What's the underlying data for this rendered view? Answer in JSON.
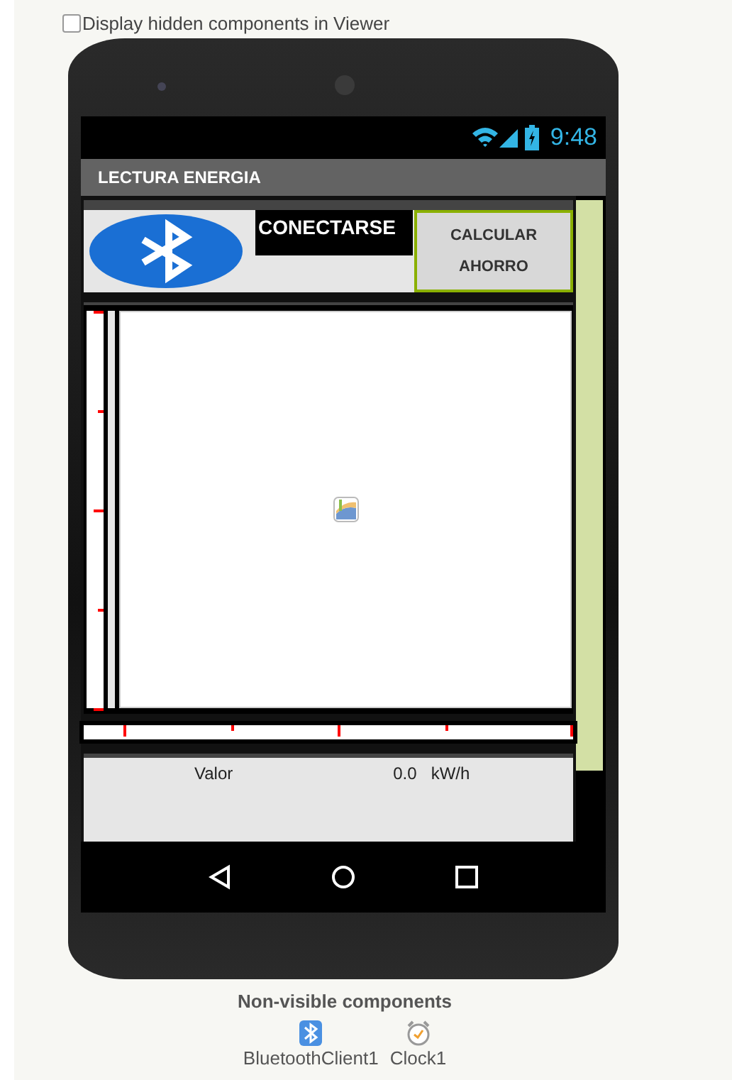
{
  "viewer_option": {
    "label": "Display hidden components in Viewer",
    "checked": false
  },
  "status_bar": {
    "time": "9:48"
  },
  "app_title": "LECTURA ENERGIA",
  "connect_label": "CONECTARSE",
  "calculate_button": "CALCULAR AHORRO",
  "reading": {
    "label": "Valor",
    "value": "0.0",
    "unit": "kW/h"
  },
  "non_visible": {
    "title": "Non-visible components",
    "components": [
      {
        "name": "BluetoothClient1",
        "kind": "bluetooth"
      },
      {
        "name": "Clock1",
        "kind": "clock"
      }
    ]
  }
}
